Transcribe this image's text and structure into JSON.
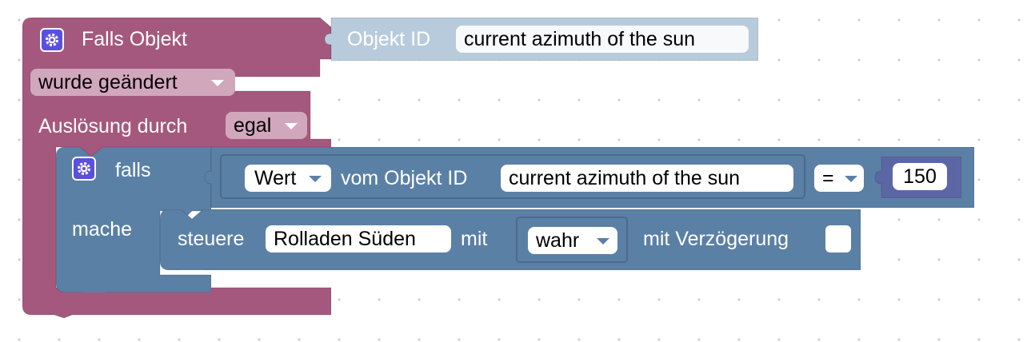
{
  "colors": {
    "event_block": "#a5587e",
    "event_dropdown": "#d1a7bc",
    "if_block": "#5b80a5",
    "value_block": "#5b80a5",
    "compare_block": "#5b80a5",
    "number_block": "#5b67a5",
    "control_block": "#5b80a5",
    "objectid_block": "#b8cbdd",
    "gear": "#5a4fe0"
  },
  "event_block": {
    "title": "Falls Objekt",
    "trigger_dropdown": "wurde geändert",
    "ausloesung_label": "Auslösung durch",
    "ausloesung_value": "egal",
    "gear_icon": "gear-icon"
  },
  "objectid_block": {
    "label": "Objekt ID",
    "value": "current azimuth of the sun"
  },
  "if_block": {
    "if_label": "falls",
    "do_label": "mache",
    "gear_icon": "gear-icon"
  },
  "condition": {
    "value_dropdown": "Wert",
    "value_label": "vom Objekt ID",
    "object_id": "current azimuth of the sun",
    "operator": "=",
    "number": "150"
  },
  "control_block": {
    "label": "steuere",
    "target": "Rolladen Süden",
    "with_label": "mit",
    "value": "wahr",
    "delay_label": "mit Verzögerung",
    "delay_checked": false
  }
}
